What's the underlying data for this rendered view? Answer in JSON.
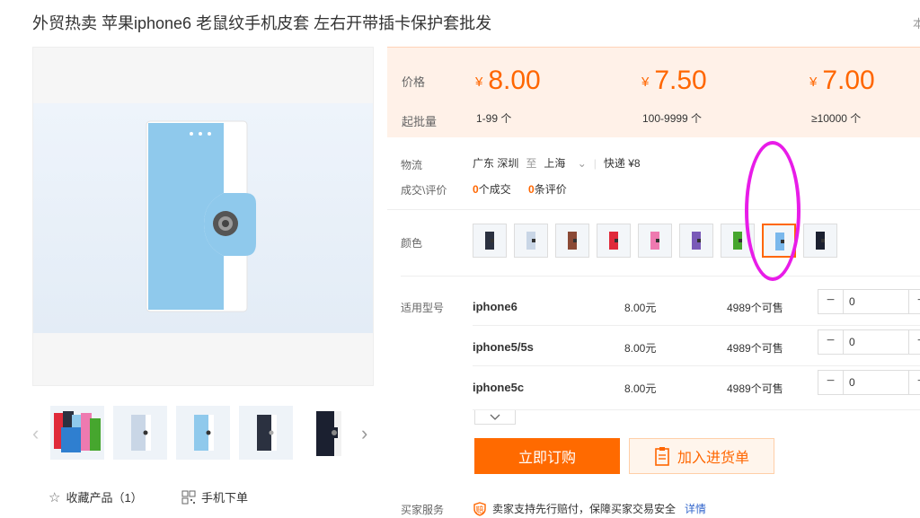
{
  "product": {
    "title": "外贸热卖 苹果iphone6 老鼠纹手机皮套 左右开带插卡保护套批发",
    "title_right": "本"
  },
  "gallery": {
    "thumbnails": [
      "multi-color-case",
      "grey-case",
      "blue-case",
      "navy-case",
      "black-case"
    ]
  },
  "utilities": {
    "favorite_label": "收藏产品（1）",
    "mobile_label": "手机下单"
  },
  "pricing": {
    "price_label": "价格",
    "moq_label": "起批量",
    "currency": "¥",
    "tiers": [
      {
        "price": "8.00",
        "range": "1-99 个"
      },
      {
        "price": "7.50",
        "range": "100-9999 个"
      },
      {
        "price": "7.00",
        "range": "≥10000 个"
      }
    ],
    "accent_color": "#ff6600"
  },
  "logistics": {
    "label": "物流",
    "origin": "广东 深圳",
    "to": "至",
    "destination": "上海",
    "shipping": "快递 ¥8"
  },
  "transactions": {
    "label": "成交\\评价",
    "deals_count": "0",
    "deals_text": "个成交",
    "review_count": "0",
    "review_text": "条评价"
  },
  "colors": {
    "label": "颜色",
    "selected_index": 7,
    "swatches": [
      "#2b3140",
      "#c9d6e6",
      "#8b4a36",
      "#e02a3a",
      "#ee7ab0",
      "#7a5ab8",
      "#46a62e",
      "#7ab8ec",
      "#1b2030"
    ]
  },
  "models": {
    "label": "适用型号",
    "rows": [
      {
        "model": "iphone6",
        "price": "8.00元",
        "stock": "4989个可售",
        "qty": "0"
      },
      {
        "model": "iphone5/5s",
        "price": "8.00元",
        "stock": "4989个可售",
        "qty": "0"
      },
      {
        "model": "iphone5c",
        "price": "8.00元",
        "stock": "4989个可售",
        "qty": "0"
      }
    ]
  },
  "actions": {
    "buy_now": "立即订购",
    "add_to_list": "加入进货单"
  },
  "service": {
    "label": "买家服务",
    "text": "卖家支持先行赔付，保障买家交易安全",
    "link": "详情"
  }
}
